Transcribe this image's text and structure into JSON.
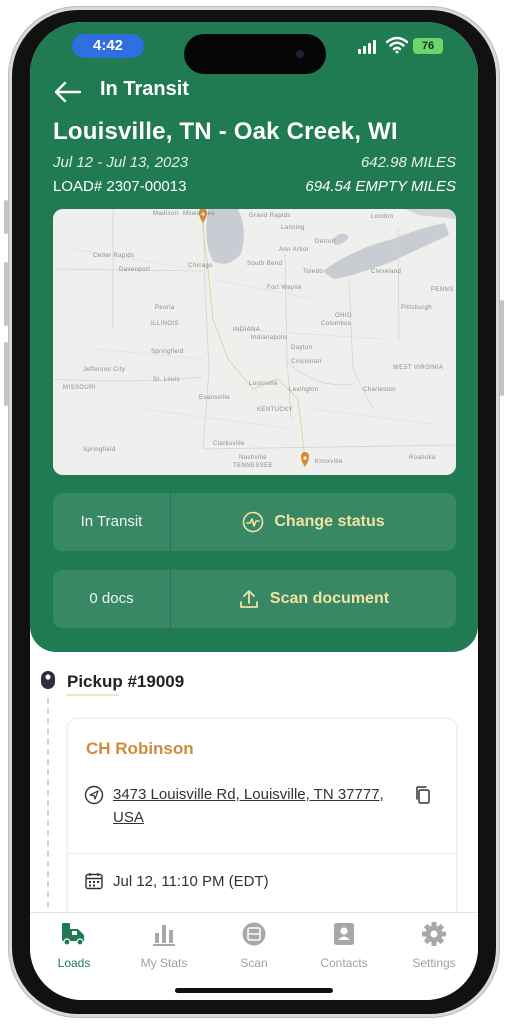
{
  "status_bar": {
    "time": "4:42",
    "battery": "76"
  },
  "header": {
    "title": "In Transit",
    "route": "Louisville, TN - Oak Creek, WI",
    "dates": "Jul 12 - Jul 13, 2023",
    "miles": "642.98 MILES",
    "load_number": "LOAD# 2307-00013",
    "empty_miles": "694.54 EMPTY MILES"
  },
  "map": {
    "labels": [
      "Madison",
      "Milwaukee",
      "Grand Rapids",
      "Lansing",
      "London",
      "Detroit",
      "Toledo",
      "Ann Arbor",
      "Cleveland",
      "Chicago",
      "South Bend",
      "Cedar Rapids",
      "Davenport",
      "Peoria",
      "Fort Wayne",
      "ILLINOIS",
      "INDIANA",
      "OHIO",
      "Columbus",
      "Pittsburgh",
      "Indianapolis",
      "Springfield",
      "Dayton",
      "Cincinnati",
      "MISSOURI",
      "Jefferson City",
      "St. Louis",
      "Louisville",
      "Lexington",
      "KENTUCKY",
      "WEST VIRGINIA",
      "Charleston",
      "Evansville",
      "Clarksville",
      "Nashville",
      "TENNESSEE",
      "Knoxville",
      "Springfield",
      "Roanoke",
      "PENNS"
    ],
    "pin_color": "#d88a2c"
  },
  "status_card": {
    "current": "In Transit",
    "action": "Change status"
  },
  "docs_card": {
    "count": "0 docs",
    "action": "Scan document"
  },
  "pickup": {
    "title": "Pickup #19009",
    "company": "CH Robinson",
    "address": "3473 Louisville Rd, Louisville, TN 37777, USA",
    "appointment": "Jul 12, 11:10 PM (EDT)"
  },
  "tabs": [
    {
      "label": "Loads",
      "icon": "truck-icon",
      "active": true
    },
    {
      "label": "My Stats",
      "icon": "bar-chart-icon",
      "active": false
    },
    {
      "label": "Scan",
      "icon": "scan-icon",
      "active": false
    },
    {
      "label": "Contacts",
      "icon": "contact-card-icon",
      "active": false
    },
    {
      "label": "Settings",
      "icon": "gear-icon",
      "active": false
    }
  ],
  "colors": {
    "brand_green": "#207a52",
    "accent_gold": "#f2e3a0",
    "company_orange": "#cf8b3e"
  }
}
